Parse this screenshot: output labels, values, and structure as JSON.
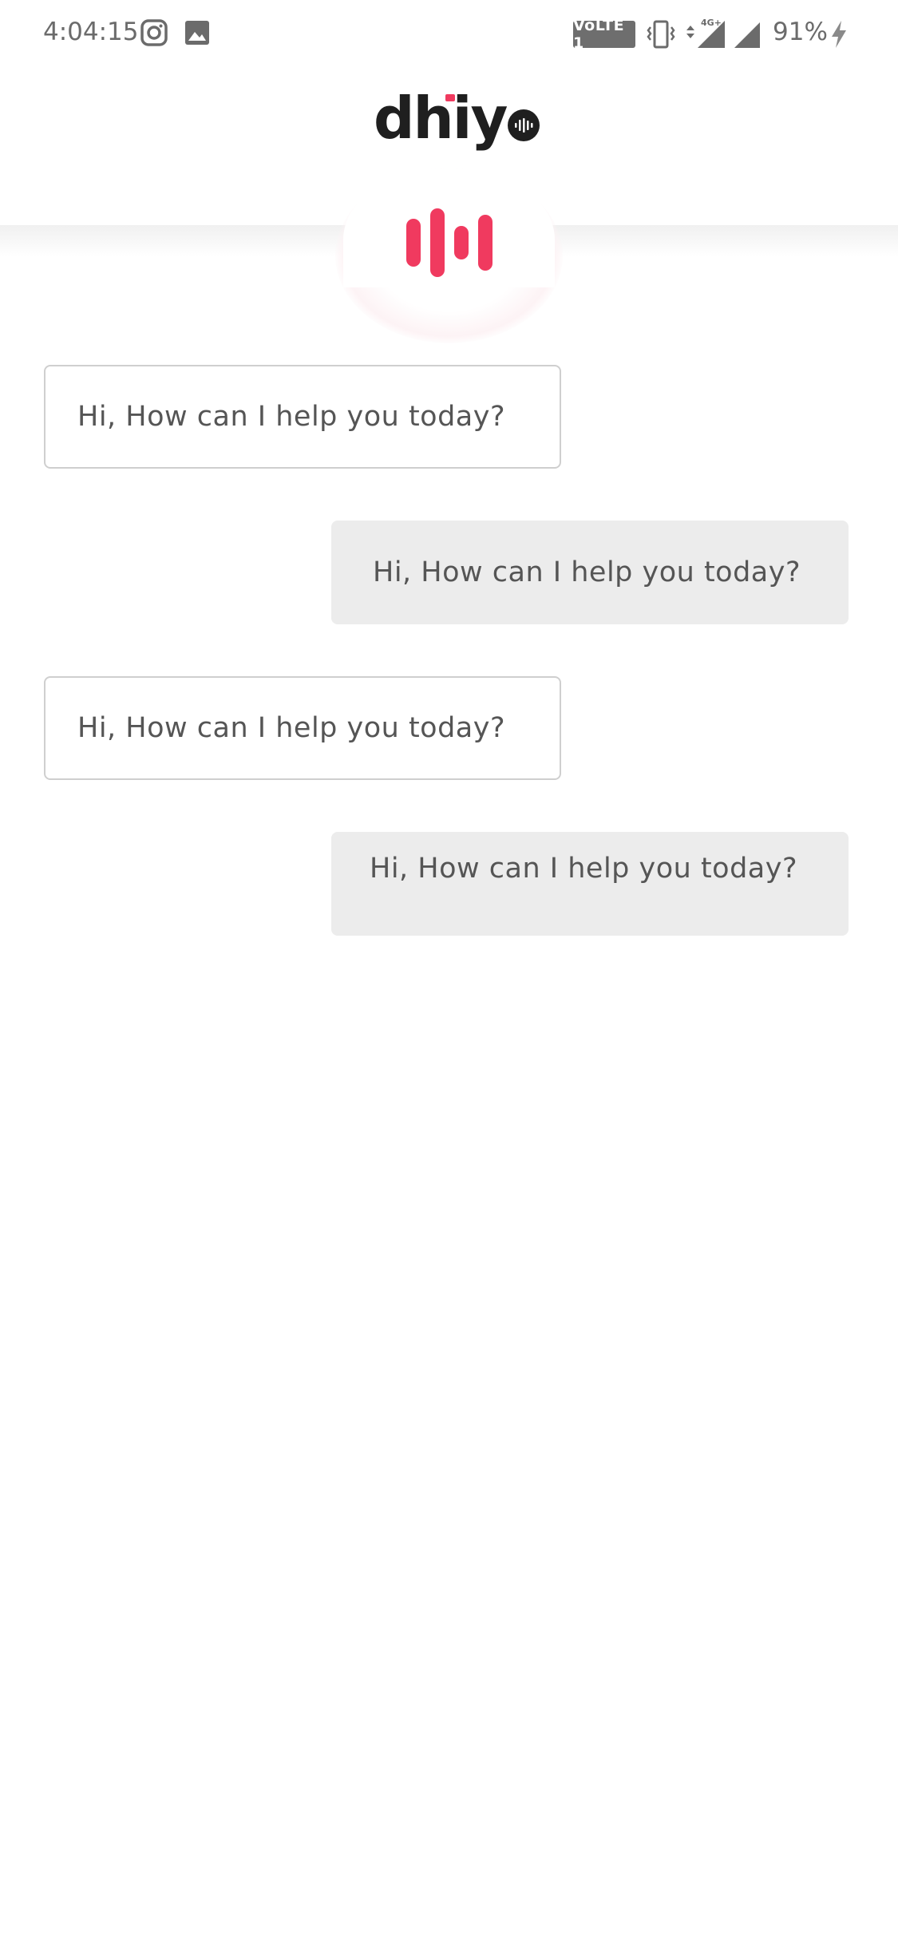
{
  "status_bar": {
    "time": "4:04:15",
    "volte_label": "VoLTE 1",
    "network_label": "4G+",
    "battery_percent": "91%",
    "icons": [
      "instagram-icon",
      "gallery-icon",
      "vibrate-icon",
      "signal-icon",
      "signal-icon",
      "charging-icon"
    ]
  },
  "header": {
    "logo_text": "dhiyo",
    "logo_prefix": "dhiy"
  },
  "colors": {
    "accent": "#f03a5f",
    "text": "#555555",
    "user_bubble_bg": "#ececec",
    "bot_bubble_border": "#cfcfcf"
  },
  "messages": [
    {
      "sender": "bot",
      "text": "Hi, How can I help you today?"
    },
    {
      "sender": "user",
      "text": "Hi, How can I help you today?"
    },
    {
      "sender": "bot",
      "text": "Hi, How can I help you today?"
    },
    {
      "sender": "user",
      "text": "Hi, How can I help you today?"
    }
  ]
}
